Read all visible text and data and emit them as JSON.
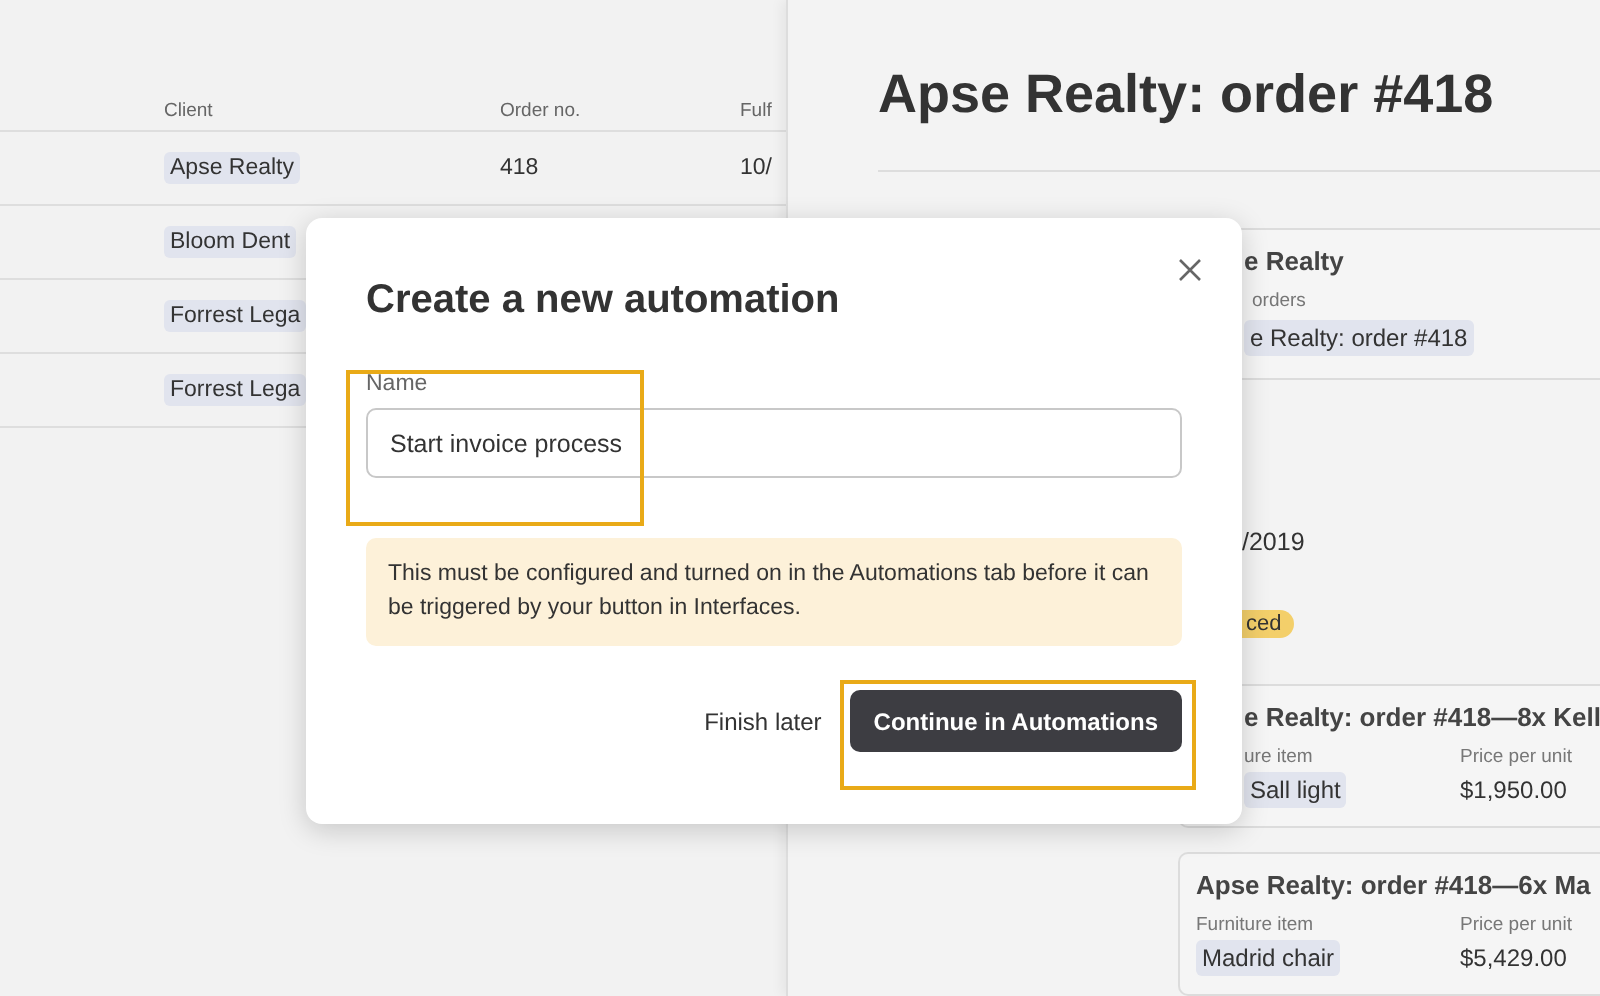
{
  "table": {
    "columns": [
      "Client",
      "Order no.",
      "Fulf"
    ],
    "rows": [
      {
        "client": "Apse Realty",
        "order_no": "418",
        "column_3": "10/"
      },
      {
        "client": "Bloom Dent"
      },
      {
        "client": "Forrest Lega"
      },
      {
        "client": "Forrest Lega"
      }
    ]
  },
  "record": {
    "title": "Apse Realty: order #418",
    "client_card": {
      "name": "e Realty",
      "label": "orders",
      "link": "e Realty: order #418"
    },
    "date": "/2019",
    "status_badge": "ced",
    "line_items": [
      {
        "title": "e Realty: order #418—8x Kell",
        "labels": [
          "ure item",
          "Price per unit"
        ],
        "item": "Sall light",
        "price": "$1,950.00"
      },
      {
        "title": "Apse Realty: order #418—6x Ma",
        "labels": [
          "Furniture item",
          "Price per unit"
        ],
        "item": "Madrid chair",
        "price": "$5,429.00"
      }
    ]
  },
  "dialog": {
    "title": "Create a new automation",
    "name_field": {
      "label": "Name",
      "value": "Start invoice process"
    },
    "note": "This must be configured and turned on in the Automations tab before it can be triggered by your button in Interfaces.",
    "buttons": [
      {
        "label": "Finish later",
        "kind": "link"
      },
      {
        "label": "Continue in Automations",
        "kind": "primary"
      }
    ]
  }
}
